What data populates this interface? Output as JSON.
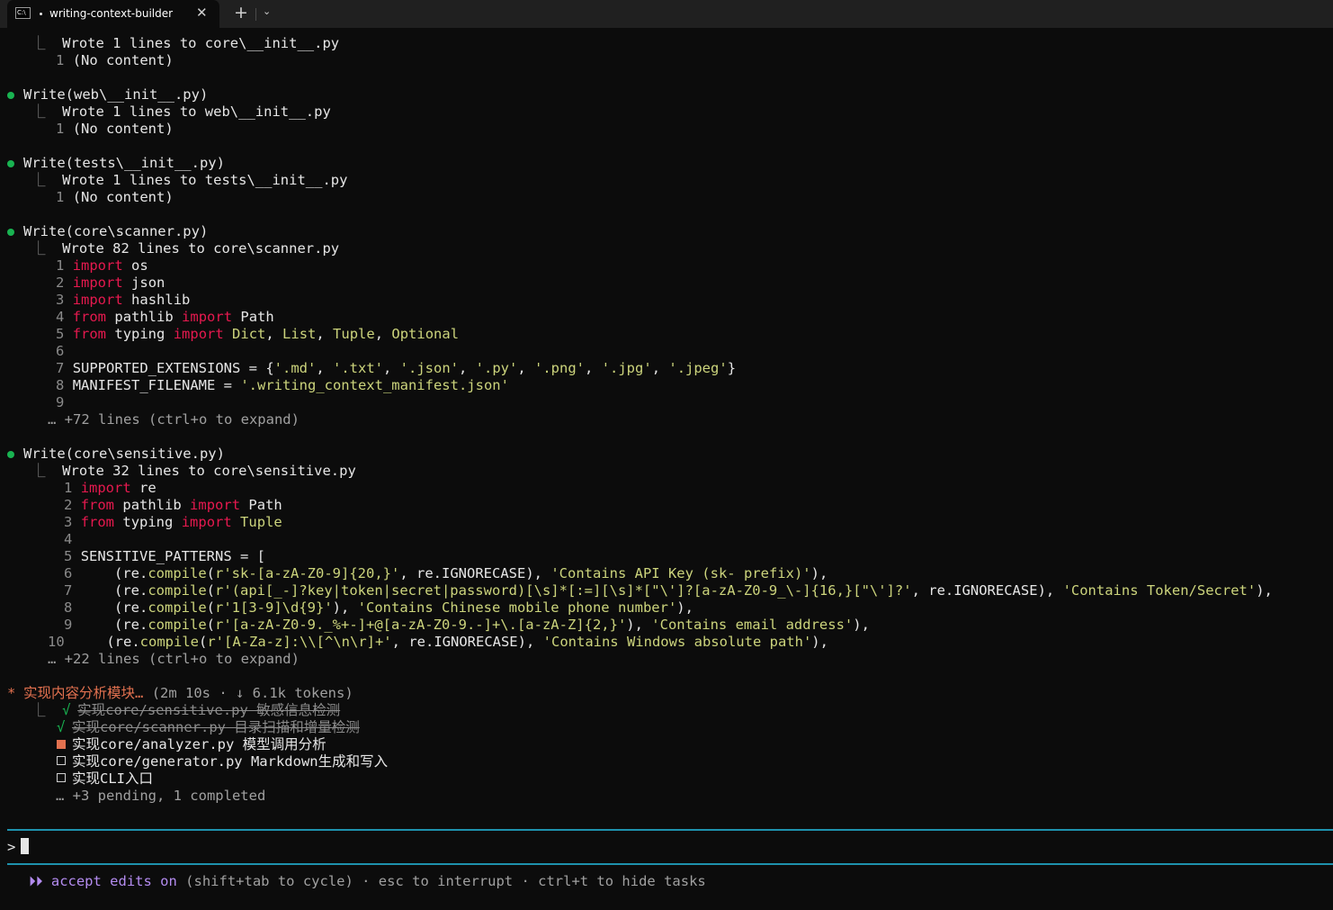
{
  "tab": {
    "icon_text": "C:\\",
    "title": "writing-context-builder",
    "close": "✕",
    "new_tab": "+",
    "dropdown": "⌄"
  },
  "lines": {
    "l1": "Wrote 1 lines to core\\__init__.py",
    "l2n": "1",
    "l2": "(No content)",
    "w1": "Write(web\\__init__.py)",
    "w1a": "Wrote 1 lines to web\\__init__.py",
    "w1n": "1",
    "w1b": "(No content)",
    "w2": "Write(tests\\__init__.py)",
    "w2a": "Wrote 1 lines to tests\\__init__.py",
    "w2n": "1",
    "w2b": "(No content)",
    "w3": "Write(core\\scanner.py)",
    "w3a": "Wrote 82 lines to core\\scanner.py",
    "w3more": "… +72 lines (ctrl+o to expand)",
    "w4": "Write(core\\sensitive.py)",
    "w4a": "Wrote 32 lines to core\\sensitive.py",
    "w4more": "… +22 lines (ctrl+o to expand)"
  },
  "scanner_code": {
    "n1": "1",
    "n2": "2",
    "n3": "3",
    "n4": "4",
    "n5": "5",
    "n6": "6",
    "n7": "7",
    "n8": "8",
    "n9": "9",
    "import": "import",
    "from": "from",
    "os": "os",
    "json": "json",
    "hashlib": "hashlib",
    "pathlib": "pathlib",
    "Path": "Path",
    "typing": "typing",
    "Dict": "Dict",
    "List": "List",
    "Tuple": "Tuple",
    "Optional": "Optional",
    "supported": "SUPPORTED_EXTENSIONS = {",
    "ext_md": "'.md'",
    "ext_txt": "'.txt'",
    "ext_json": "'.json'",
    "ext_py": "'.py'",
    "ext_png": "'.png'",
    "ext_jpg": "'.jpg'",
    "ext_jpeg": "'.jpeg'",
    "manifest": "MANIFEST_FILENAME = ",
    "manifest_val": "'.writing_context_manifest.json'"
  },
  "sensitive_code": {
    "n1": "1",
    "n2": "2",
    "n3": "3",
    "n4": "4",
    "n5": "5",
    "n6": "6",
    "n7": "7",
    "n8": "8",
    "n9": "9",
    "n10": "10",
    "re": "re",
    "pathlib": "pathlib",
    "Path": "Path",
    "typing": "typing",
    "Tuple": "Tuple",
    "patterns": "SENSITIVE_PATTERNS = [",
    "compile": "compile",
    "rx6": "r'sk-[a-zA-Z0-9]{20,}'",
    "msg6": "'Contains API Key (sk- prefix)'",
    "rx7": "r'(api[_-]?key|token|secret|password)[\\s]*[:=][\\s]*[\"\\']?[a-zA-Z0-9_\\-]{16,}[\"\\']?'",
    "msg7": "'Contains Token/Secret'",
    "rx8": "r'1[3-9]\\d{9}'",
    "msg8": "'Contains Chinese mobile phone number'",
    "rx9": "r'[a-zA-Z0-9._%+-]+@[a-zA-Z0-9.-]+\\.[a-zA-Z]{2,}'",
    "msg9": "'Contains email address'",
    "rx10": "r'[A-Za-z]:\\\\[^\\n\\r]+'",
    "msg10": "'Contains Windows absolute path'",
    "ignore": "re.IGNORECASE"
  },
  "task": {
    "title": "实现内容分析模块…",
    "meta": "(2m 10s · ↓ 6.1k tokens)",
    "items": [
      {
        "mark": "√",
        "text": "实现core/sensitive.py 敏感信息检测"
      },
      {
        "mark": "√",
        "text": "实现core/scanner.py 目录扫描和增量检测"
      },
      {
        "mark": "■",
        "text": "实现core/analyzer.py 模型调用分析"
      },
      {
        "mark": "□",
        "text": "实现core/generator.py Markdown生成和写入"
      },
      {
        "mark": "□",
        "text": "实现CLI入口"
      }
    ],
    "more": "… +3 pending, 1 completed"
  },
  "prompt": {
    "symbol": ">"
  },
  "status": {
    "arrows": "⏵⏵",
    "mode": "accept edits on",
    "rest": " (shift+tab to cycle) · esc to interrupt · ctrl+t to hide tasks"
  },
  "colors": {
    "accent": "#b48cf0",
    "rule": "#1e92ad",
    "bullet": "#19b351",
    "active": "#e2714f",
    "keyword": "#e6194f",
    "string": "#ccd47c"
  }
}
